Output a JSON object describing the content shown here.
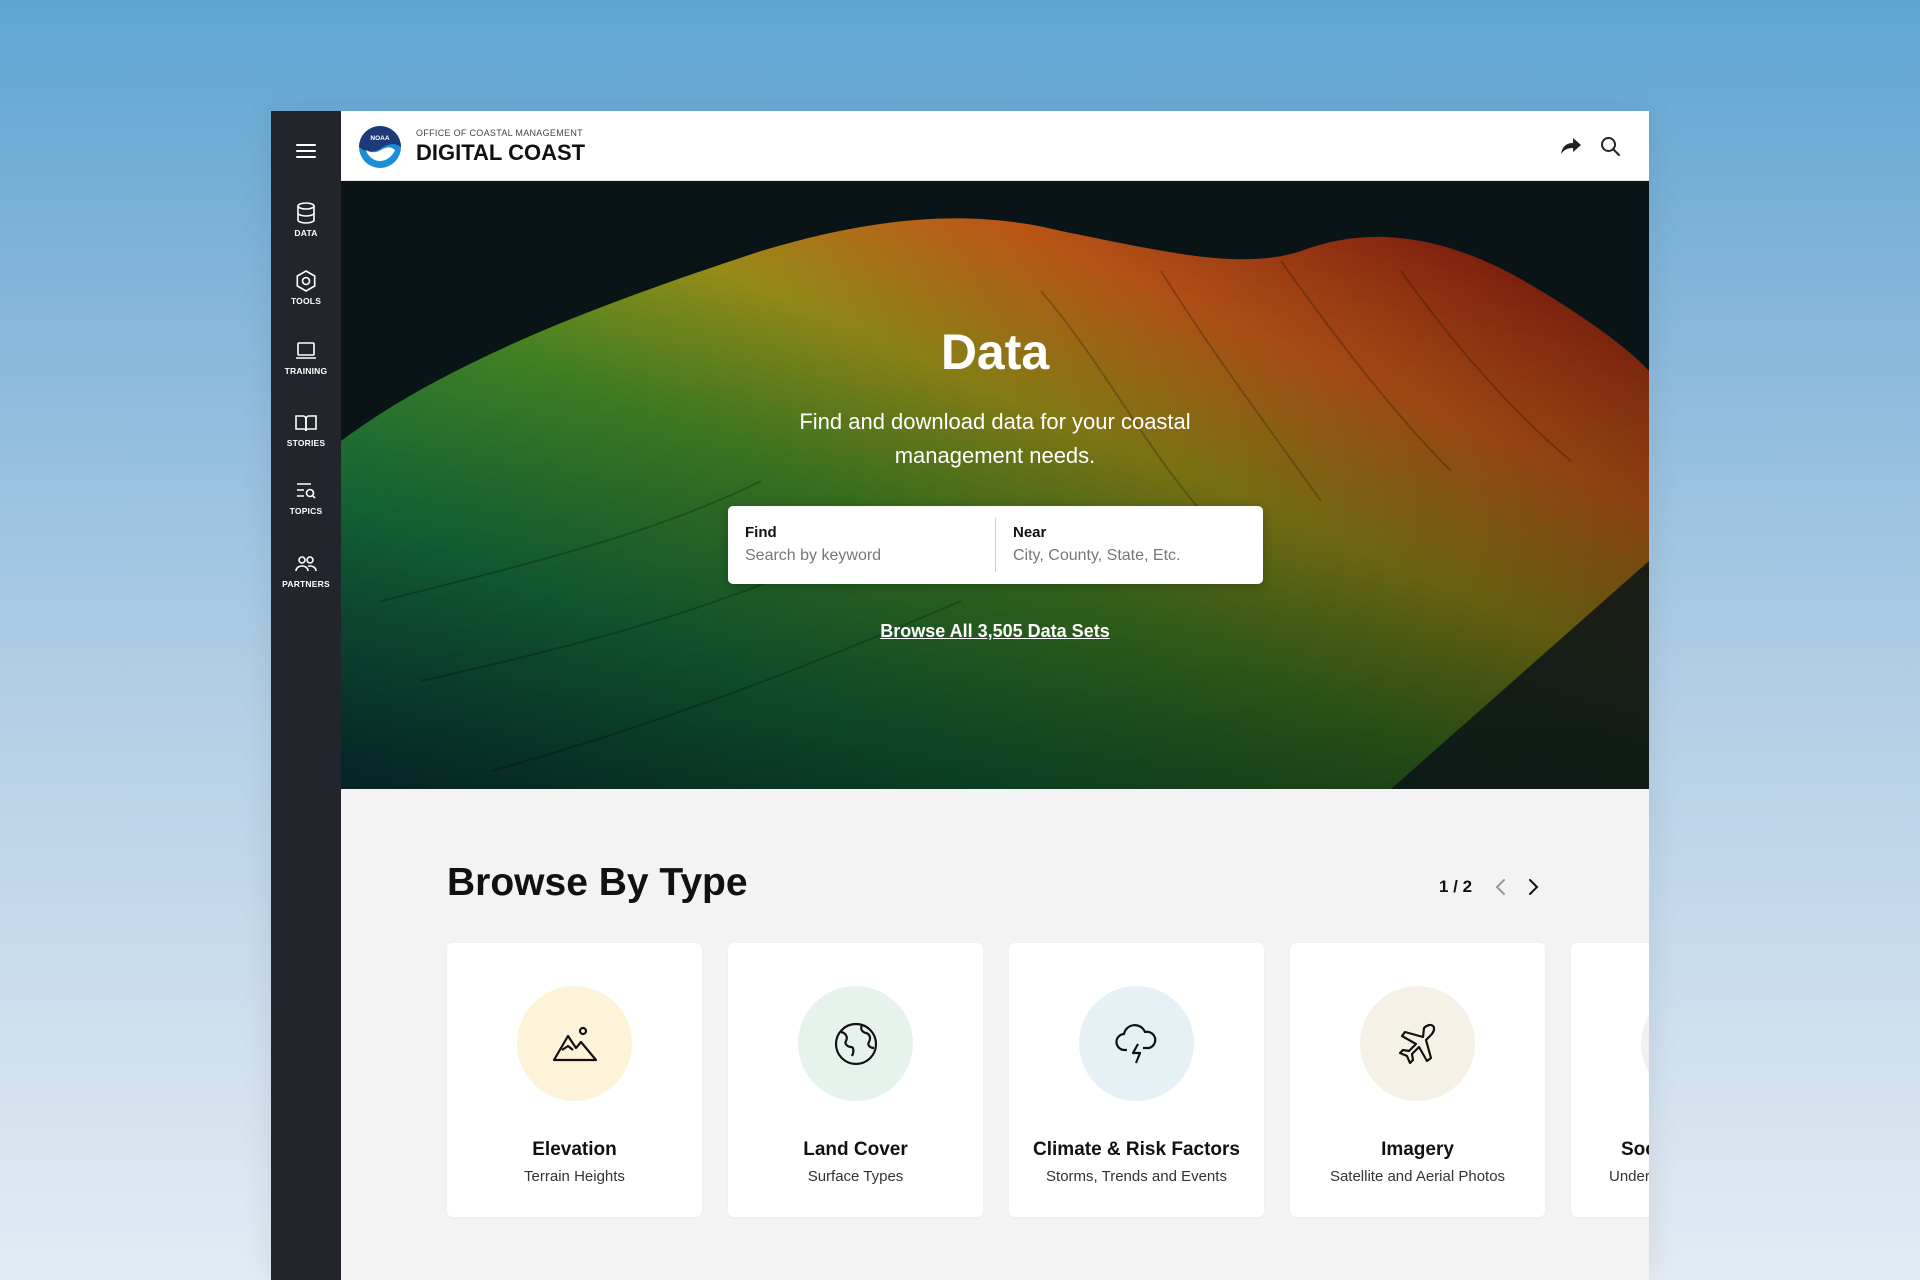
{
  "sidebar": {
    "items": [
      {
        "label": "DATA",
        "icon": "database-icon"
      },
      {
        "label": "TOOLS",
        "icon": "hexagon-nut-icon"
      },
      {
        "label": "TRAINING",
        "icon": "laptop-icon"
      },
      {
        "label": "STORIES",
        "icon": "open-book-icon"
      },
      {
        "label": "TOPICS",
        "icon": "list-search-icon"
      },
      {
        "label": "PARTNERS",
        "icon": "people-group-icon"
      }
    ]
  },
  "header": {
    "logo_text": "NOAA",
    "brand_small": "OFFICE OF COASTAL MANAGEMENT",
    "brand_big": "DIGITAL COAST"
  },
  "hero": {
    "title": "Data",
    "subtitle": "Find and download data for your coastal management needs.",
    "find_label": "Find",
    "find_placeholder": "Search by keyword",
    "near_label": "Near",
    "near_placeholder": "City, County, State, Etc.",
    "browse_link": "Browse All 3,505 Data Sets"
  },
  "browse": {
    "title": "Browse By Type",
    "pager": "1 / 2",
    "cards": [
      {
        "title": "Elevation",
        "subtitle": "Terrain Heights",
        "icon": "mountain-icon",
        "color": "#fdf3d9"
      },
      {
        "title": "Land Cover",
        "subtitle": "Surface Types",
        "icon": "globe-icon",
        "color": "#e6f3ec"
      },
      {
        "title": "Climate & Risk Factors",
        "subtitle": "Storms, Trends and Events",
        "icon": "storm-cloud-icon",
        "color": "#e6f1f6"
      },
      {
        "title": "Imagery",
        "subtitle": "Satellite and Aerial Photos",
        "icon": "airplane-icon",
        "color": "#f5f1e6"
      },
      {
        "title": "Soc",
        "subtitle": "Under",
        "icon": "partial-card-icon",
        "color": "#f2f0f4"
      }
    ]
  }
}
